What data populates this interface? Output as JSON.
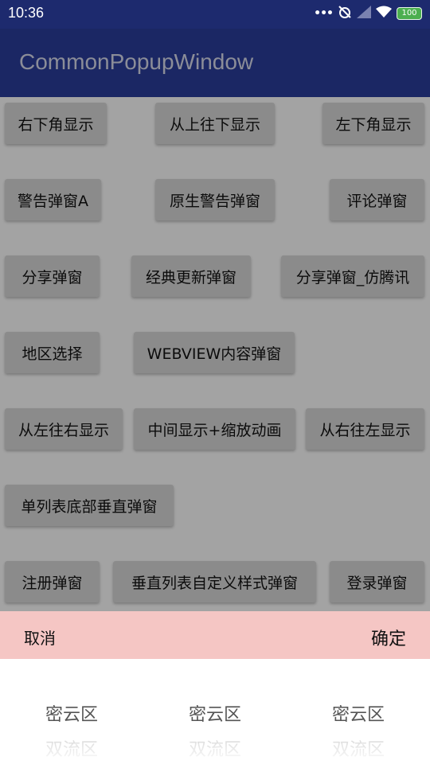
{
  "status_bar": {
    "time": "10:36",
    "battery": "100"
  },
  "app_bar": {
    "title": "CommonPopupWindow"
  },
  "buttons": {
    "b1": "右下角显示",
    "b2": "从上往下显示",
    "b3": "左下角显示",
    "b4": "警告弹窗A",
    "b5": "原生警告弹窗",
    "b6": "评论弹窗",
    "b7": "分享弹窗",
    "b8": "经典更新弹窗",
    "b9": "分享弹窗_仿腾讯",
    "b10": "地区选择",
    "b11": "WEBVIEW内容弹窗",
    "b12": "从左往右显示",
    "b13": "中间显示+缩放动画",
    "b14": "从右往左显示",
    "b15": "单列表底部垂直弹窗",
    "b16": "注册弹窗",
    "b17": "垂直列表自定义样式弹窗",
    "b18": "登录弹窗"
  },
  "picker": {
    "cancel_label": "取消",
    "confirm_label": "确定",
    "columns": [
      {
        "selected": "密云区",
        "next": "双流区"
      },
      {
        "selected": "密云区",
        "next": "双流区"
      },
      {
        "selected": "密云区",
        "next": "双流区"
      }
    ]
  },
  "colors": {
    "status_bar": "#1d2a6e",
    "app_bar": "#2a3c9a",
    "picker_header": "#f5c6c4",
    "button": "#d6d6d6"
  }
}
